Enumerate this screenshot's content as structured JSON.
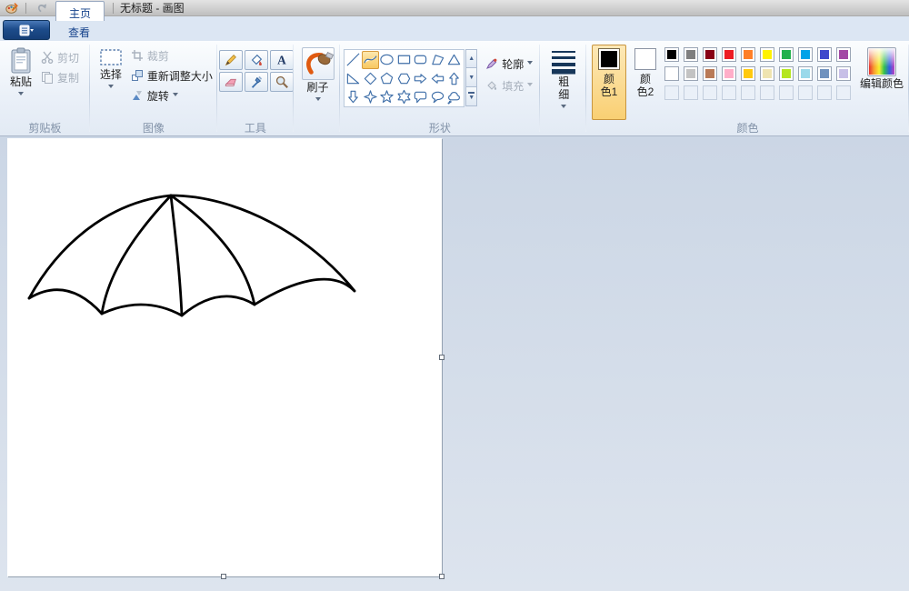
{
  "titlebar": {
    "title": "无标题 - 画图",
    "icons": [
      "paint-app-icon",
      "redo-icon",
      "undo-icon",
      "save-icon",
      "qat-dropdown-icon"
    ]
  },
  "menu": {
    "tabs": [
      {
        "label": "主页",
        "active": true
      },
      {
        "label": "查看",
        "active": false
      }
    ]
  },
  "ribbon": {
    "clipboard": {
      "label": "剪贴板",
      "paste": "粘贴",
      "cut": "剪切",
      "copy": "复制"
    },
    "image": {
      "label": "图像",
      "select": "选择",
      "crop": "裁剪",
      "resize": "重新调整大小",
      "rotate": "旋转"
    },
    "tools": {
      "label": "工具",
      "items": [
        "pencil",
        "fill",
        "text",
        "eraser",
        "color-picker",
        "magnifier"
      ]
    },
    "brushes": {
      "label": "刷子"
    },
    "shapes": {
      "label": "形状",
      "outline": "轮廓",
      "fill": "填充",
      "selected": "curve",
      "items": [
        "line",
        "curve",
        "ellipse",
        "rectangle",
        "rounded-rectangle",
        "polygon",
        "triangle",
        "right-triangle",
        "diamond",
        "pentagon",
        "hexagon",
        "arrow-right",
        "arrow-left",
        "arrow-up",
        "arrow-down",
        "star-4",
        "star-5",
        "star-6",
        "callout-rounded",
        "callout-ellipse",
        "callout-cloud"
      ]
    },
    "size": {
      "label": "粗细"
    },
    "colors": {
      "label": "颜色",
      "color1_label": "颜\n色1",
      "color2_label": "颜\n色2",
      "color1_value": "#000000",
      "color2_value": "#ffffff",
      "edit_colors": "编辑颜色",
      "palette_row1": [
        "#000000",
        "#7f7f7f",
        "#880015",
        "#ed1c24",
        "#ff7f27",
        "#fff200",
        "#22b14c",
        "#00a2e8",
        "#3f48cc",
        "#a349a4"
      ],
      "palette_row2": [
        "#ffffff",
        "#c3c3c3",
        "#b97a57",
        "#ffaec9",
        "#ffc90e",
        "#efe4b0",
        "#b5e61d",
        "#99d9ea",
        "#7092be",
        "#c8bfe7"
      ],
      "empty_slots": 10
    }
  },
  "canvas": {
    "drawing": {
      "subject": "hand-drawn umbrella canopy",
      "stroke_color": "#000000",
      "paths": [
        "M180,63 C112,70 57,116 24,176",
        "M180,63 C252,63 332,106 382,168",
        "M180,63 C147,98 112,143 104,193",
        "M180,63 C184,98 190,148 192,195",
        "M180,63 C227,96 262,136 272,183",
        "M24,176 Q66,151 104,193",
        "M104,193 Q150,172 192,195",
        "M192,195 Q234,160 272,183",
        "M272,183 C312,158 357,143 382,168"
      ]
    }
  }
}
